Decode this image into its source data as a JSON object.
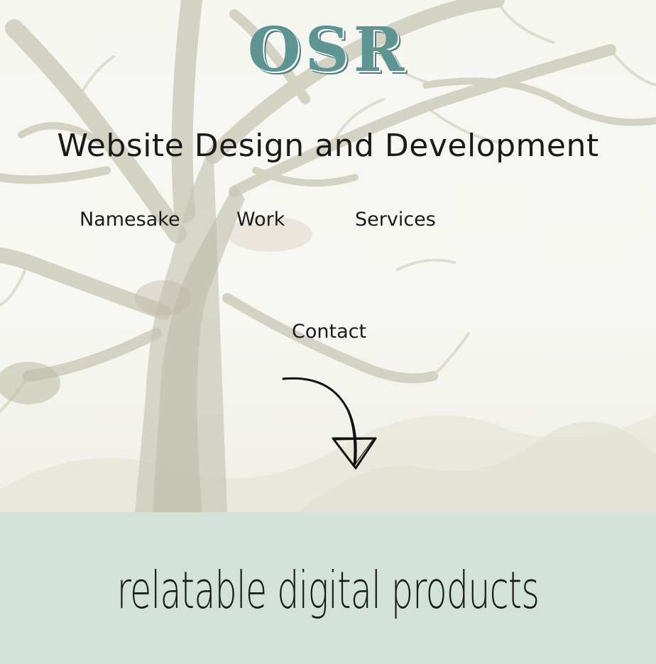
{
  "logo": {
    "text": "OSR"
  },
  "tagline": "Website Design and Development",
  "nav": {
    "namesake": "Namesake",
    "work": "Work",
    "services": "Services",
    "contact": "Contact"
  },
  "icons": {
    "scroll": "curved-arrow-down-icon"
  },
  "band": {
    "text": "relatable digital products"
  },
  "colors": {
    "brand": "#5e9593",
    "band_background": "#d3e2d8",
    "text": "#1a1a1a"
  }
}
